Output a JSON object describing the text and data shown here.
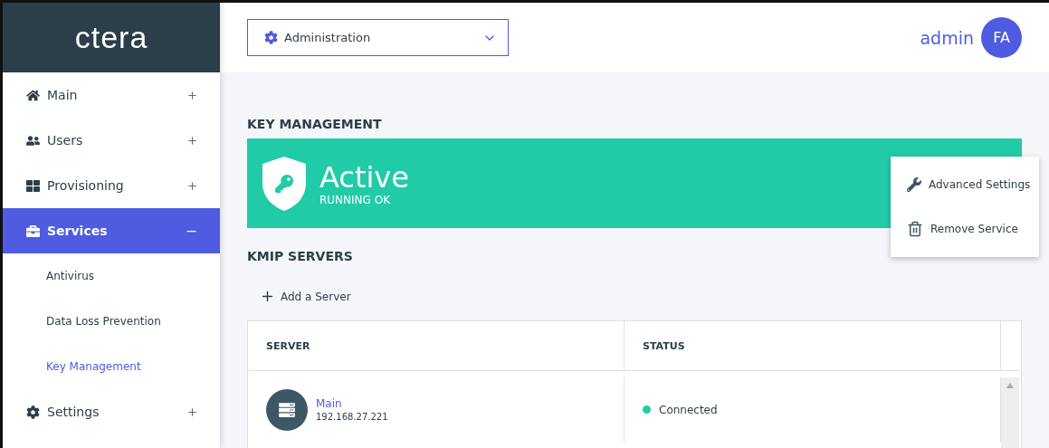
{
  "logo": "ctera",
  "sidebar": {
    "items": [
      {
        "label": "Main",
        "kind": "home",
        "expanded": false,
        "selected": false
      },
      {
        "label": "Users",
        "kind": "users",
        "expanded": false,
        "selected": false
      },
      {
        "label": "Provisioning",
        "kind": "grid",
        "expanded": false,
        "selected": false
      },
      {
        "label": "Services",
        "kind": "briefcase",
        "expanded": true,
        "selected": true,
        "children": [
          {
            "label": "Antivirus",
            "selected": false
          },
          {
            "label": "Data Loss Prevention",
            "selected": false
          },
          {
            "label": "Key Management",
            "selected": true
          }
        ]
      },
      {
        "label": "Settings",
        "kind": "gear",
        "expanded": false,
        "selected": false
      }
    ]
  },
  "header": {
    "context_select": {
      "value": "Administration"
    },
    "user_name": "admin",
    "avatar_initials": "FA"
  },
  "page_title": "KEY MANAGEMENT",
  "status_banner": {
    "title": "Active",
    "subtitle": "RUNNING OK",
    "color": "#22cba8"
  },
  "section_title": "KMIP SERVERS",
  "add_button": "Add a Server",
  "table": {
    "columns": [
      "SERVER",
      "STATUS"
    ],
    "rows": [
      {
        "name": "Main",
        "address": "192.168.27.221",
        "status": "Connected",
        "color": "#22cba8"
      }
    ]
  },
  "menu": {
    "items": [
      {
        "label": "Advanced Settings",
        "kind": "wrench"
      },
      {
        "label": "Remove Service",
        "kind": "trash"
      }
    ]
  }
}
